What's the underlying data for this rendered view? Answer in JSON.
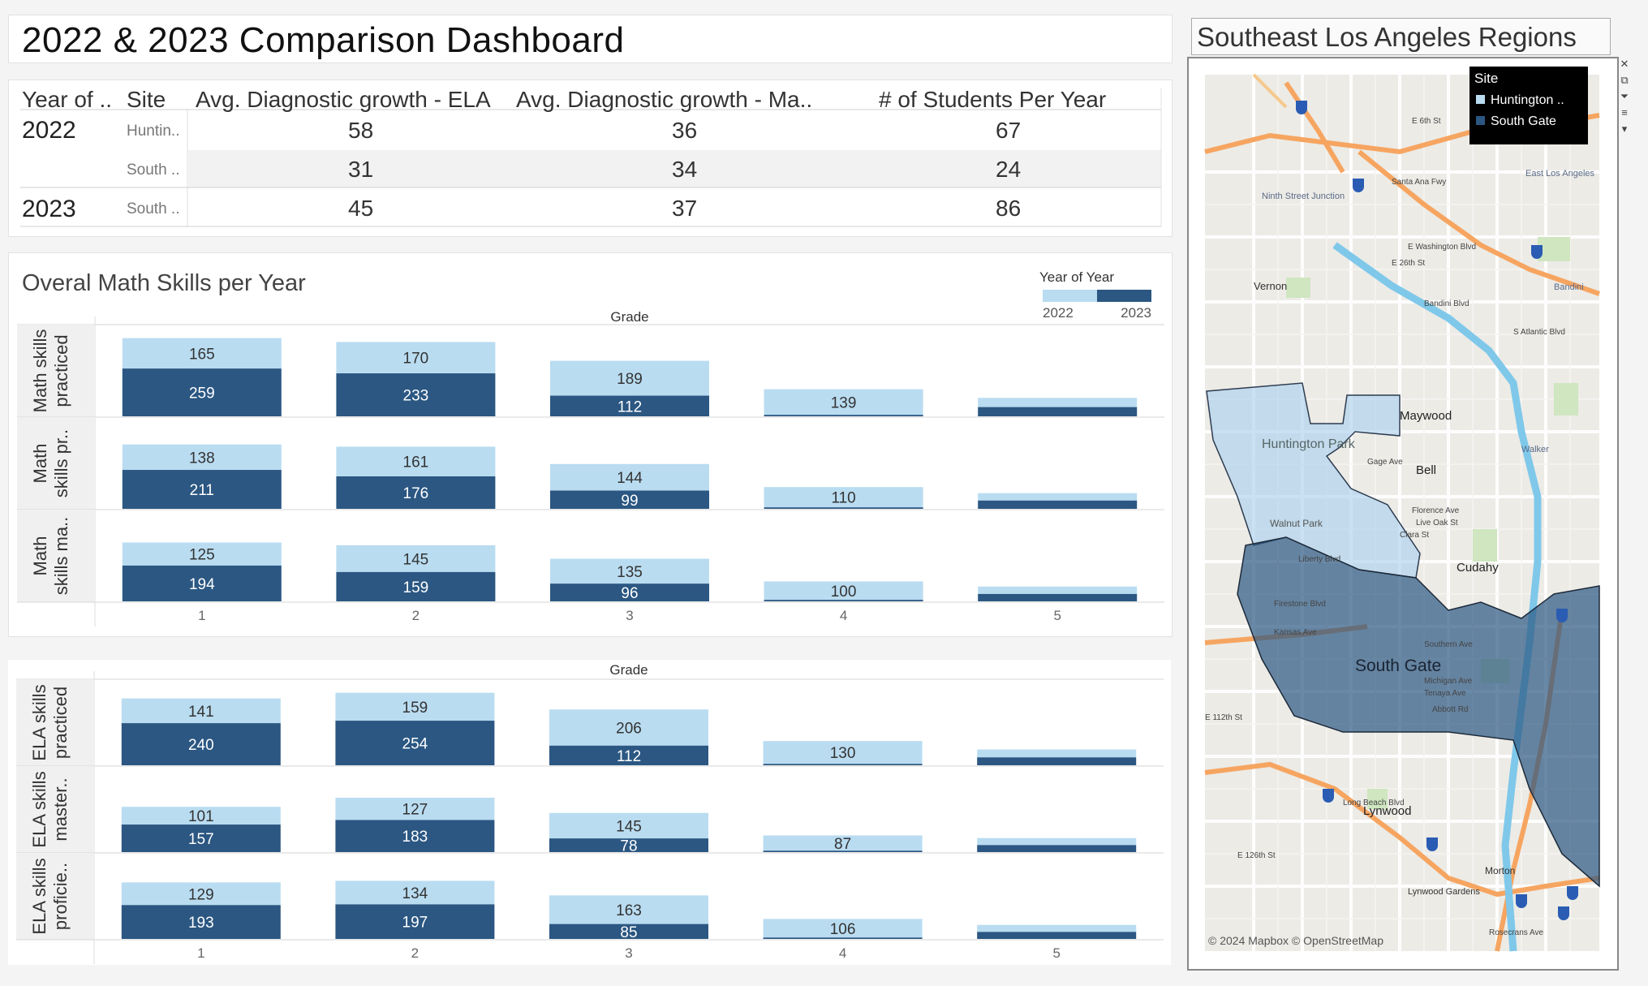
{
  "dashboard": {
    "title": "2022 & 2023 Comparison Dashboard"
  },
  "summary_table": {
    "headers": [
      "Year of ..",
      "Site",
      "Avg. Diagnostic growth - ELA",
      "Avg. Diagnostic growth - Ma..",
      "# of Students Per Year"
    ],
    "rows": [
      {
        "year": "2022",
        "site": "Huntin..",
        "ela": "58",
        "math": "36",
        "students": "67"
      },
      {
        "year": "",
        "site": "South ..",
        "ela": "31",
        "math": "34",
        "students": "24"
      },
      {
        "year": "2023",
        "site": "South ..",
        "ela": "45",
        "math": "37",
        "students": "86"
      }
    ]
  },
  "colors": {
    "y2022": "#b9dcf1",
    "y2023": "#2b5782",
    "line": "#d6d6d6",
    "text_dark": "#333333"
  },
  "legend": {
    "title": "Year of Year",
    "labels": [
      "2022",
      "2023"
    ]
  },
  "math_chart": {
    "title": "Overal Math Skills per Year",
    "column_header": "Grade",
    "grades": [
      "1",
      "2",
      "3",
      "4",
      "5"
    ],
    "ymax": 440,
    "rows": [
      {
        "label_lines": [
          "Math skills",
          "practiced"
        ],
        "y2022": [
          165,
          170,
          189,
          139,
          50
        ],
        "y2023": [
          259,
          233,
          112,
          8,
          50
        ],
        "label22": [
          "165",
          "170",
          "189",
          "139",
          ""
        ],
        "label23": [
          "259",
          "233",
          "112",
          "",
          ""
        ]
      },
      {
        "label_lines": [
          "Math",
          "skills pr.."
        ],
        "y2022": [
          138,
          161,
          144,
          110,
          40
        ],
        "y2023": [
          211,
          176,
          99,
          8,
          45
        ],
        "label22": [
          "138",
          "161",
          "144",
          "110",
          ""
        ],
        "label23": [
          "211",
          "176",
          "99",
          "",
          ""
        ]
      },
      {
        "label_lines": [
          "Math",
          "skills ma.."
        ],
        "y2022": [
          125,
          145,
          135,
          100,
          40
        ],
        "y2023": [
          194,
          159,
          96,
          8,
          40
        ],
        "label22": [
          "125",
          "145",
          "135",
          "100",
          ""
        ],
        "label23": [
          "194",
          "159",
          "96",
          "",
          ""
        ]
      }
    ]
  },
  "ela_chart": {
    "column_header": "Grade",
    "grades": [
      "1",
      "2",
      "3",
      "4",
      "5"
    ],
    "ymax": 430,
    "rows": [
      {
        "label_lines": [
          "ELA skills",
          "practiced"
        ],
        "y2022": [
          141,
          159,
          206,
          130,
          45
        ],
        "y2023": [
          240,
          254,
          112,
          8,
          45
        ],
        "label22": [
          "141",
          "159",
          "206",
          "130",
          ""
        ],
        "label23": [
          "240",
          "254",
          "112",
          "",
          ""
        ]
      },
      {
        "label_lines": [
          "ELA skills",
          "master.."
        ],
        "y2022": [
          101,
          127,
          145,
          87,
          40
        ],
        "y2023": [
          157,
          183,
          78,
          8,
          40
        ],
        "label22": [
          "101",
          "127",
          "145",
          "87",
          ""
        ],
        "label23": [
          "157",
          "183",
          "78",
          "",
          ""
        ]
      },
      {
        "label_lines": [
          "ELA skills",
          "proficie.."
        ],
        "y2022": [
          129,
          134,
          163,
          106,
          40
        ],
        "y2023": [
          193,
          197,
          85,
          8,
          40
        ],
        "label22": [
          "129",
          "134",
          "163",
          "106",
          ""
        ],
        "label23": [
          "193",
          "197",
          "85",
          "",
          ""
        ]
      }
    ]
  },
  "map": {
    "title": "Southeast Los Angeles Regions",
    "legend_title": "Site",
    "legend_items": [
      "Huntington ..",
      "South Gate"
    ],
    "attribution": "© 2024 Mapbox © OpenStreetMap",
    "region_labels": [
      "Huntington Park",
      "South Gate"
    ],
    "places": [
      "Maywood",
      "Bell",
      "Cudahy",
      "Lynwood",
      "Vernon",
      "Walnut Park",
      "Ninth Street Junction",
      "East Los Angeles",
      "Bandini",
      "Walker",
      "Lynwood Gardens",
      "Morton"
    ],
    "streets": [
      "E 6th St",
      "Santa Ana Fwy",
      "E Washington Blvd",
      "E 26th St",
      "Bandini Blvd",
      "S Atlantic Blvd",
      "Gage Ave",
      "Florence Ave",
      "Firestone Blvd",
      "Southern Ave",
      "Abbott Rd",
      "Long Beach Blvd",
      "Rosecrans Ave",
      "E 112th St",
      "E 126th St",
      "Liberty Blvd",
      "Clara St",
      "Live Oak St",
      "Kansas Ave",
      "Michigan Ave",
      "Tenaya Ave"
    ]
  }
}
